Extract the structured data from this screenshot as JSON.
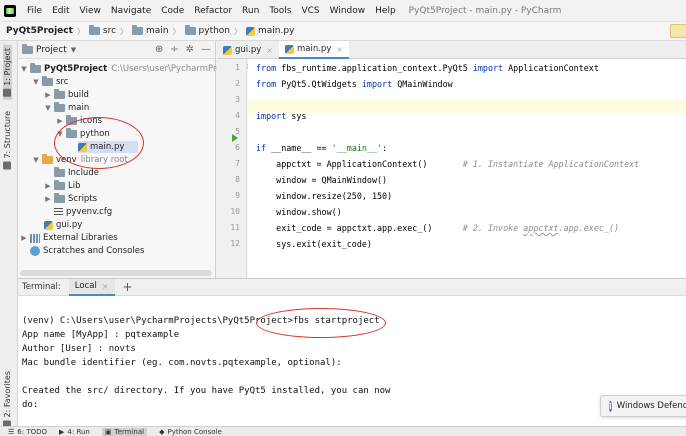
{
  "menubar": {
    "items": [
      "File",
      "Edit",
      "View",
      "Navigate",
      "Code",
      "Refactor",
      "Run",
      "Tools",
      "VCS",
      "Window",
      "Help"
    ],
    "window_title": "PyQt5Project - main.py - PyCharm"
  },
  "breadcrumb": {
    "items": [
      "PyQt5Project",
      "src",
      "main",
      "python",
      "main.py"
    ]
  },
  "left_strip": {
    "project_tab": "1: Project",
    "structure_tab": "7: Structure",
    "favorites_tab": "2: Favorites"
  },
  "project_panel": {
    "title": "Project",
    "root_name": "PyQt5Project",
    "root_path": "C:\\Users\\user\\PycharmProjects\\Py",
    "tree": {
      "src": "src",
      "build": "build",
      "main": "main",
      "icons": "icons",
      "python": "python",
      "main_py": "main.py",
      "venv": "venv",
      "venv_note": "library root",
      "include": "Include",
      "lib": "Lib",
      "scripts": "Scripts",
      "pyvenv": "pyvenv.cfg",
      "gui_py": "gui.py",
      "external_libs": "External Libraries",
      "scratches": "Scratches and Consoles"
    }
  },
  "editor": {
    "tabs": [
      {
        "label": "gui.py",
        "active": false
      },
      {
        "label": "main.py",
        "active": true
      }
    ],
    "line_numbers": [
      "1",
      "2",
      "3",
      "4",
      "5",
      "6",
      "7",
      "8",
      "9",
      "10",
      "11",
      "12"
    ]
  },
  "code": {
    "l1_kw1": "from",
    "l1_mod": " fbs_runtime.application_context.PyQt5 ",
    "l1_kw2": "import",
    "l1_name": " ApplicationContext",
    "l2_kw1": "from",
    "l2_mod": " PyQt5.QtWidgets ",
    "l2_kw2": "import",
    "l2_name": " QMainWindow",
    "l4_kw": "import",
    "l4_name": " sys",
    "l6_kw": "if",
    "l6_mid": " __name__ == ",
    "l6_str": "'__main__'",
    "l6_end": ":",
    "l7_code": "    appctxt = ApplicationContext()       ",
    "l7_cmt": "# 1. Instantiate ApplicationContext",
    "l8_code": "    window = QMainWindow()",
    "l9_code": "    window.resize(250, 150)",
    "l10_code": "    window.show()",
    "l11_code": "    exit_code = appctxt.app.exec_()      ",
    "l11_cmt1": "# 2. Invoke ",
    "l11_cmt_ul": "appctxt",
    "l11_cmt2": ".app.exec_()",
    "l12_code": "    sys.exit(exit_code)"
  },
  "terminal": {
    "label": "Terminal:",
    "tab": "Local",
    "lines": [
      "(venv) C:\\Users\\user\\PycharmProjects\\PyQt5Project>fbs startproject",
      "App name [MyApp] : pqtexample",
      "Author [User] : novts",
      "Mac bundle identifier (eg. com.novts.pqtexample, optional):",
      "",
      "Created the src/ directory. If you have PyQt5 installed, you can now",
      "do:"
    ]
  },
  "notification": {
    "text": "Windows Defende"
  },
  "bottom_bar": {
    "todo": "6: TODO",
    "run": "4: Run",
    "terminal": "Terminal",
    "python_console": "Python Console"
  }
}
